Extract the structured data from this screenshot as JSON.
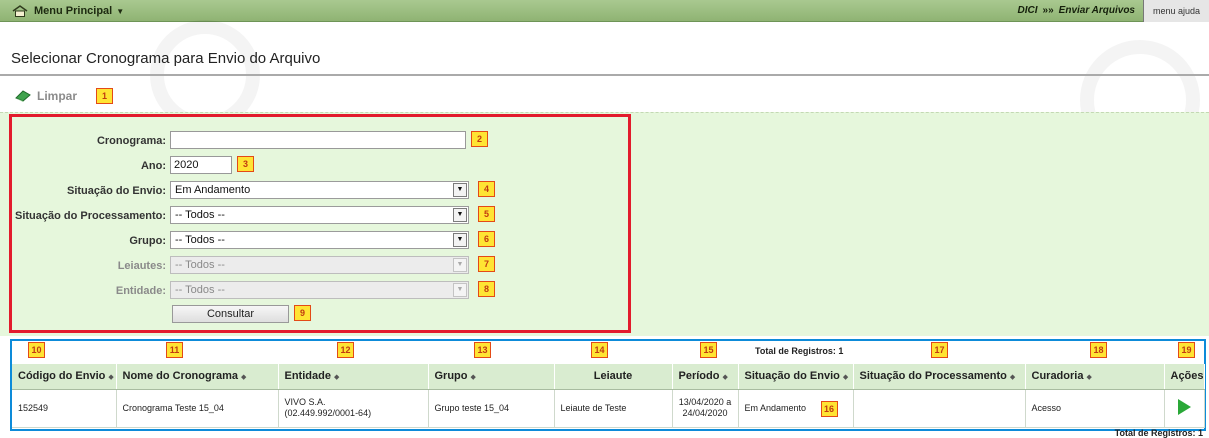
{
  "topbar": {
    "menu_label": "Menu Principal",
    "breadcrumb_section": "DICI",
    "breadcrumb_separator": "»»",
    "breadcrumb_page": "Enviar Arquivos",
    "menu_link": "menu",
    "help_link": "ajuda"
  },
  "page": {
    "title": "Selecionar Cronograma para Envio do Arquivo",
    "limpar_label": "Limpar"
  },
  "form": {
    "cronograma_label": "Cronograma:",
    "cronograma_value": "",
    "ano_label": "Ano:",
    "ano_value": "2020",
    "situacao_envio_label": "Situação do Envio:",
    "situacao_envio_value": "Em Andamento",
    "situacao_processamento_label": "Situação do Processamento:",
    "situacao_processamento_value": "-- Todos --",
    "grupo_label": "Grupo:",
    "grupo_value": "-- Todos --",
    "leiautes_label": "Leiautes:",
    "leiautes_value": "-- Todos --",
    "entidade_label": "Entidade:",
    "entidade_value": "-- Todos --",
    "consultar_label": "Consultar"
  },
  "results": {
    "total_label": "Total de Registros: 1",
    "columns": [
      "Código do Envio",
      "Nome do Cronograma",
      "Entidade",
      "Grupo",
      "Leiaute",
      "Período",
      "Situação do Envio",
      "Situação do Processamento",
      "Curadoria",
      "Ações"
    ],
    "rows": [
      {
        "codigo": "152549",
        "nome": "Cronograma Teste 15_04",
        "entidade_nome": "VIVO S.A.",
        "entidade_cnpj": "(02.449.992/0001-64)",
        "grupo": "Grupo teste 15_04",
        "leiaute": "Leiaute de Teste",
        "periodo_inicio": "13/04/2020 a",
        "periodo_fim": "24/04/2020",
        "situacao_envio": "Em Andamento",
        "situacao_processamento": "",
        "curadoria": "Acesso"
      }
    ]
  },
  "badges": [
    "1",
    "2",
    "3",
    "4",
    "5",
    "6",
    "7",
    "8",
    "9",
    "10",
    "11",
    "12",
    "13",
    "14",
    "15",
    "16",
    "17",
    "18",
    "19"
  ],
  "colors": {
    "topbar": "#9bbf7f",
    "filter_bg": "#e6f7dc",
    "red_box": "#e21b2c",
    "blue_box": "#0d8bd9",
    "header_bg": "#d9ecd0",
    "badge_fill": "#ffe433",
    "play": "#2aa838"
  },
  "icons": {
    "menu": "home-icon",
    "limpar": "eraser-icon",
    "acoes": "play-icon"
  }
}
